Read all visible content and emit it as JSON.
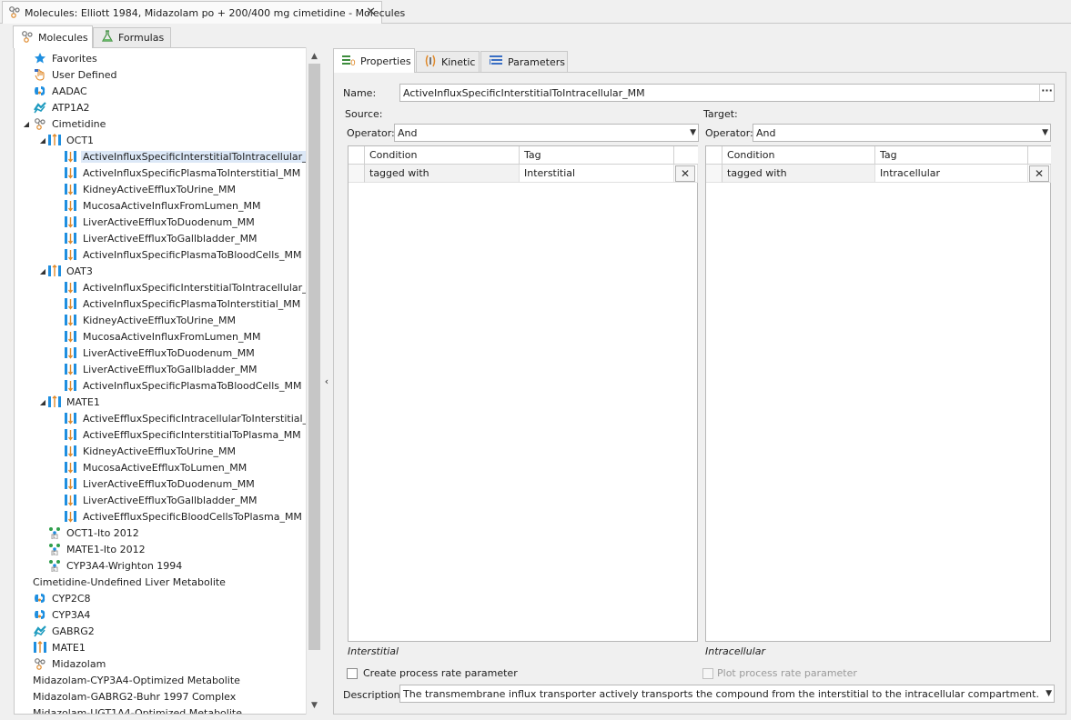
{
  "document_tab": {
    "title": "Molecules: Elliott 1984, Midazolam po + 200/400 mg cimetidine - Molecules",
    "close_glyph": "✕"
  },
  "left_tabs": [
    {
      "label": "Molecules",
      "icon": "molecule-icon"
    },
    {
      "label": "Formulas",
      "icon": "flask-icon"
    }
  ],
  "tree": [
    {
      "label": "Favorites",
      "icon": "star-icon",
      "depth": 0
    },
    {
      "label": "User Defined",
      "icon": "user-defined-icon",
      "depth": 0
    },
    {
      "label": "AADAC",
      "icon": "enzyme-icon",
      "depth": 0
    },
    {
      "label": "ATP1A2",
      "icon": "protein-icon",
      "depth": 0
    },
    {
      "label": "Cimetidine",
      "icon": "molecule-icon",
      "depth": 0,
      "expanded": true
    },
    {
      "label": "OCT1",
      "icon": "transporter-icon",
      "depth": 1,
      "expanded": true
    },
    {
      "label": "ActiveInfluxSpecificInterstitialToIntracellular_MM",
      "icon": "transporter-process-icon",
      "depth": 2,
      "selected": true
    },
    {
      "label": "ActiveInfluxSpecificPlasmaToInterstitial_MM",
      "icon": "transporter-process-icon",
      "depth": 2
    },
    {
      "label": "KidneyActiveEffluxToUrine_MM",
      "icon": "transporter-process-icon",
      "depth": 2
    },
    {
      "label": "MucosaActiveInfluxFromLumen_MM",
      "icon": "transporter-process-icon",
      "depth": 2
    },
    {
      "label": "LiverActiveEffluxToDuodenum_MM",
      "icon": "transporter-process-icon",
      "depth": 2
    },
    {
      "label": "LiverActiveEffluxToGallbladder_MM",
      "icon": "transporter-process-icon",
      "depth": 2
    },
    {
      "label": "ActiveInfluxSpecificPlasmaToBloodCells_MM",
      "icon": "transporter-process-icon",
      "depth": 2
    },
    {
      "label": "OAT3",
      "icon": "transporter-icon",
      "depth": 1,
      "expanded": true
    },
    {
      "label": "ActiveInfluxSpecificInterstitialToIntracellular_MM",
      "icon": "transporter-process-icon",
      "depth": 2
    },
    {
      "label": "ActiveInfluxSpecificPlasmaToInterstitial_MM",
      "icon": "transporter-process-icon",
      "depth": 2
    },
    {
      "label": "KidneyActiveEffluxToUrine_MM",
      "icon": "transporter-process-icon",
      "depth": 2
    },
    {
      "label": "MucosaActiveInfluxFromLumen_MM",
      "icon": "transporter-process-icon",
      "depth": 2
    },
    {
      "label": "LiverActiveEffluxToDuodenum_MM",
      "icon": "transporter-process-icon",
      "depth": 2
    },
    {
      "label": "LiverActiveEffluxToGallbladder_MM",
      "icon": "transporter-process-icon",
      "depth": 2
    },
    {
      "label": "ActiveInfluxSpecificPlasmaToBloodCells_MM",
      "icon": "transporter-process-icon",
      "depth": 2
    },
    {
      "label": "MATE1",
      "icon": "transporter-icon",
      "depth": 1,
      "expanded": true
    },
    {
      "label": "ActiveEffluxSpecificIntracellularToInterstitial_MM",
      "icon": "transporter-process-icon",
      "depth": 2
    },
    {
      "label": "ActiveEffluxSpecificInterstitialToPlasma_MM",
      "icon": "transporter-process-icon",
      "depth": 2
    },
    {
      "label": "KidneyActiveEffluxToUrine_MM",
      "icon": "transporter-process-icon",
      "depth": 2
    },
    {
      "label": "MucosaActiveEffluxToLumen_MM",
      "icon": "transporter-process-icon",
      "depth": 2
    },
    {
      "label": "LiverActiveEffluxToDuodenum_MM",
      "icon": "transporter-process-icon",
      "depth": 2
    },
    {
      "label": "LiverActiveEffluxToGallbladder_MM",
      "icon": "transporter-process-icon",
      "depth": 2
    },
    {
      "label": "ActiveEffluxSpecificBloodCellsToPlasma_MM",
      "icon": "transporter-process-icon",
      "depth": 2
    },
    {
      "label": "OCT1-Ito 2012",
      "icon": "inhibition-process-icon",
      "depth": 1
    },
    {
      "label": "MATE1-Ito 2012",
      "icon": "inhibition-process-icon",
      "depth": 1
    },
    {
      "label": "CYP3A4-Wrighton 1994",
      "icon": "inhibition-process-icon",
      "depth": 1
    },
    {
      "label": "Cimetidine-Undefined Liver Metabolite",
      "icon": "",
      "depth": 0
    },
    {
      "label": "CYP2C8",
      "icon": "enzyme-icon",
      "depth": 0
    },
    {
      "label": "CYP3A4",
      "icon": "enzyme-icon",
      "depth": 0
    },
    {
      "label": "GABRG2",
      "icon": "protein-icon",
      "depth": 0
    },
    {
      "label": "MATE1",
      "icon": "transporter-icon",
      "depth": 0
    },
    {
      "label": "Midazolam",
      "icon": "molecule-icon",
      "depth": 0
    },
    {
      "label": "Midazolam-CYP3A4-Optimized Metabolite",
      "icon": "",
      "depth": 0
    },
    {
      "label": "Midazolam-GABRG2-Buhr 1997 Complex",
      "icon": "",
      "depth": 0
    },
    {
      "label": "Midazolam-UGT1A4-Optimized Metabolite",
      "icon": "",
      "depth": 0
    }
  ],
  "collapse_glyph": "‹",
  "right_tabs": [
    {
      "label": "Properties",
      "icon": "properties-icon"
    },
    {
      "label": "Kinetic",
      "icon": "kinetic-icon"
    },
    {
      "label": "Parameters",
      "icon": "parameters-icon"
    }
  ],
  "properties": {
    "name_label": "Name:",
    "name_value": "ActiveInfluxSpecificInterstitialToIntracellular_MM",
    "name_button": "···",
    "source": {
      "heading": "Source:",
      "operator_label": "Operator:",
      "operator_value": "And",
      "columns": [
        "Condition",
        "Tag"
      ],
      "rows": [
        {
          "condition": "tagged with",
          "tag": "Interstitial"
        }
      ],
      "summary": "Interstitial"
    },
    "target": {
      "heading": "Target:",
      "operator_label": "Operator:",
      "operator_value": "And",
      "columns": [
        "Condition",
        "Tag"
      ],
      "rows": [
        {
          "condition": "tagged with",
          "tag": "Intracellular"
        }
      ],
      "summary": "Intracellular"
    },
    "create_rate_param_label": "Create process rate parameter",
    "create_rate_param_checked": false,
    "plot_rate_param_label": "Plot process rate parameter",
    "plot_rate_param_enabled": false,
    "description_label": "Description:",
    "description_value": "The transmembrane influx transporter actively transports the compound from the interstitial to the intracellular compartment."
  }
}
